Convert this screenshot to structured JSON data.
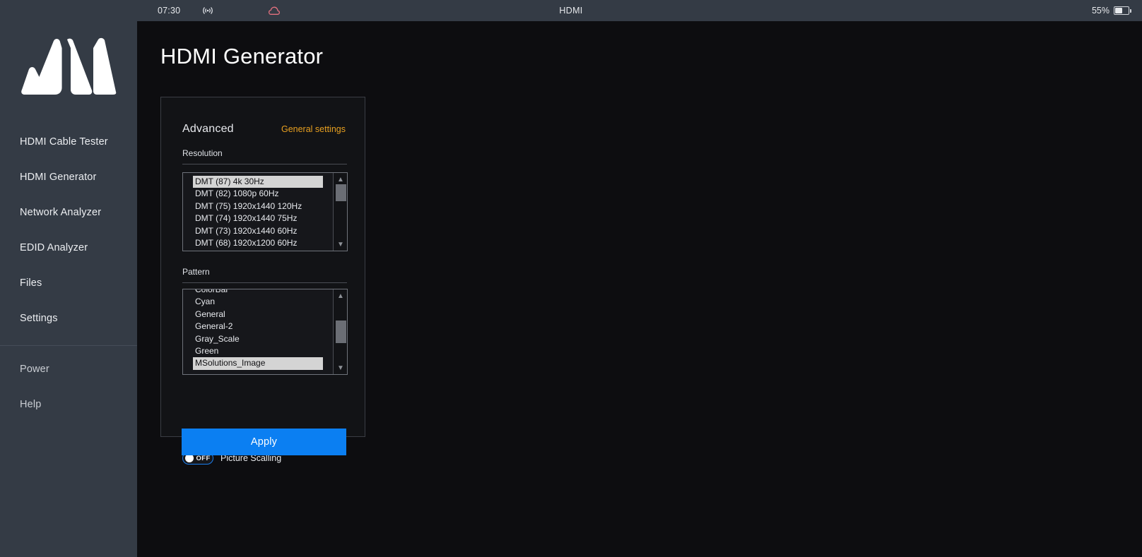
{
  "statusbar": {
    "clock": "07:30",
    "center_label": "HDMI",
    "battery_percent": "55%",
    "battery_level": 55,
    "wifi_icon": "wifi-antenna-icon",
    "cloud_icon": "cloud-icon",
    "cloud_color": "#e2717f"
  },
  "sidebar": {
    "logo_name": "msolutions-mountain-logo",
    "items": [
      {
        "label": "HDMI Cable Tester",
        "name": "sidebar-item-hdmi-cable-tester"
      },
      {
        "label": "HDMI Generator",
        "name": "sidebar-item-hdmi-generator"
      },
      {
        "label": "Network Analyzer",
        "name": "sidebar-item-network-analyzer"
      },
      {
        "label": "EDID Analyzer",
        "name": "sidebar-item-edid-analyzer"
      },
      {
        "label": "Files",
        "name": "sidebar-item-files"
      },
      {
        "label": "Settings",
        "name": "sidebar-item-settings"
      }
    ],
    "footer_items": [
      {
        "label": "Power",
        "name": "sidebar-item-power"
      },
      {
        "label": "Help",
        "name": "sidebar-item-help"
      }
    ]
  },
  "main": {
    "page_title": "HDMI Generator"
  },
  "card": {
    "title": "Advanced",
    "general_settings_link": "General settings",
    "accent_color": "#e8a020",
    "resolution": {
      "label": "Resolution",
      "selected": "DMT (87) 4k 30Hz",
      "options": [
        "DMT (87) 4k 30Hz",
        "DMT (82) 1080p 60Hz",
        "DMT (75) 1920x1440 120Hz",
        "DMT (74) 1920x1440 75Hz",
        "DMT (73) 1920x1440 60Hz",
        "DMT (68) 1920x1200 60Hz"
      ]
    },
    "pattern": {
      "label": "Pattern",
      "selected": "MSolutions_Image",
      "options": [
        "ColorBar",
        "Cyan",
        "General",
        "General-2",
        "Gray_Scale",
        "Green",
        "MSolutions_Image"
      ]
    },
    "picture_scalling": {
      "label": "Picture Scalling",
      "state": "OFF"
    },
    "apply_label": "Apply",
    "apply_color": "#0b7ff2"
  }
}
